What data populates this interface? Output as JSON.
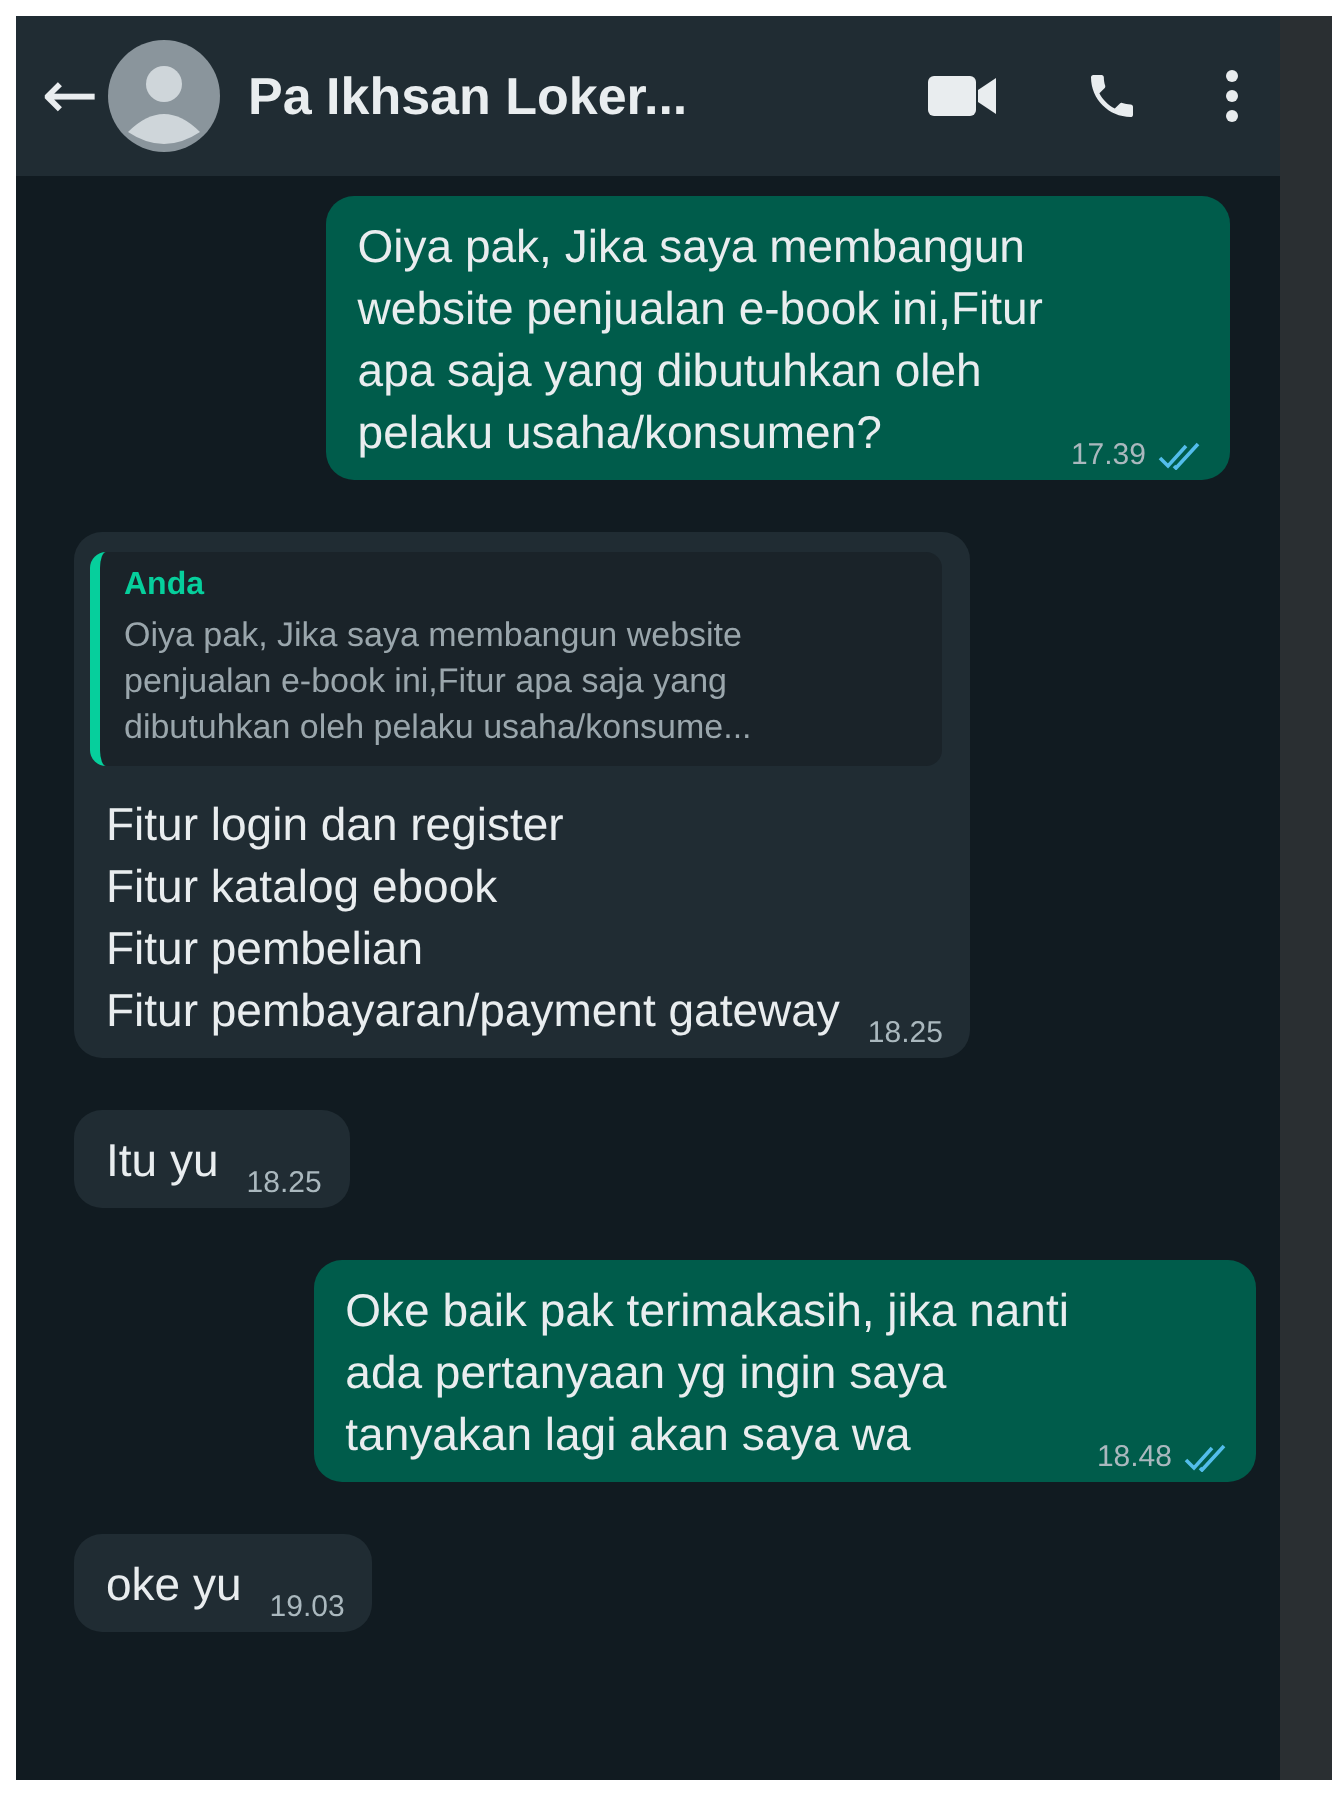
{
  "header": {
    "back": "←",
    "title": "Pa Ikhsan Loker..."
  },
  "messages": [
    {
      "kind": "outgoing",
      "text": "Oiya pak, Jika saya membangun\nwebsite penjualan e-book ini,Fitur\napa saja yang dibutuhkan oleh\npelaku usaha/konsumen?",
      "time": "17.39",
      "read": true
    },
    {
      "kind": "incoming",
      "quote": {
        "author": "Anda",
        "text": "Oiya pak, Jika saya membangun website\npenjualan e-book ini,Fitur apa saja yang\ndibutuhkan oleh pelaku usaha/konsume..."
      },
      "text": "Fitur login dan register\nFitur katalog ebook\nFitur pembelian\nFitur pembayaran/payment gateway",
      "time": "18.25"
    },
    {
      "kind": "incoming",
      "text": "Itu yu",
      "time": "18.25"
    },
    {
      "kind": "outgoing",
      "text": "Oke baik pak terimakasih, jika nanti\nada pertanyaan yg ingin saya\ntanyakan lagi akan saya wa",
      "time": "18.48",
      "read": true
    },
    {
      "kind": "incoming",
      "text": "oke yu",
      "time": "19.03"
    }
  ]
}
